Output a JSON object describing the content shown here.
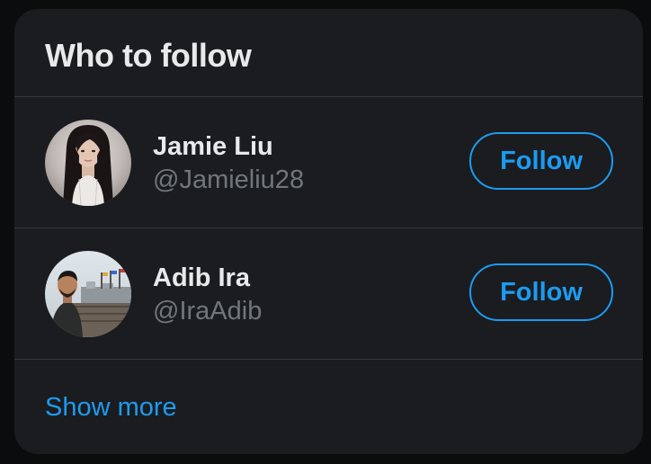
{
  "widget": {
    "title": "Who to follow",
    "show_more": "Show more"
  },
  "users": [
    {
      "display_name": "Jamie Liu",
      "handle": "@Jamieliu28",
      "follow_label": "Follow"
    },
    {
      "display_name": "Adib Ira",
      "handle": "@IraAdib",
      "follow_label": "Follow"
    }
  ],
  "colors": {
    "background": "#1a1c20",
    "accent": "#1d9bf0",
    "primary_text": "#e7e9ea",
    "secondary_text": "#71767b",
    "divider": "#34373b"
  }
}
